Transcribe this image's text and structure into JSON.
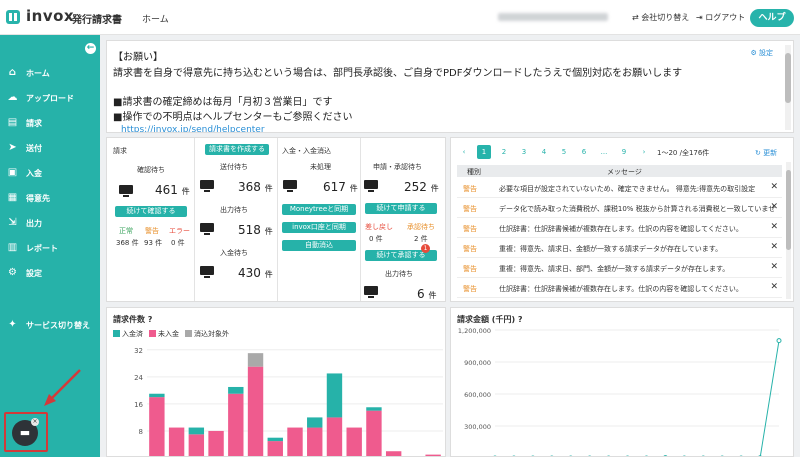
{
  "header": {
    "logo_text": "invox",
    "logo_sub": "発行請求書",
    "nav_home": "ホーム",
    "user_name": "",
    "switch_company": "会社切り替え",
    "logout": "ログアウト",
    "help": "ヘルプ"
  },
  "sidebar": {
    "items": [
      {
        "label": "ホーム",
        "icon": "home-icon"
      },
      {
        "label": "アップロード",
        "icon": "cloud-upload-icon"
      },
      {
        "label": "請求",
        "icon": "document-icon"
      },
      {
        "label": "送付",
        "icon": "send-icon"
      },
      {
        "label": "入金",
        "icon": "inbox-icon"
      },
      {
        "label": "得意先",
        "icon": "building-icon"
      },
      {
        "label": "出力",
        "icon": "export-icon"
      },
      {
        "label": "レポート",
        "icon": "bar-chart-icon"
      },
      {
        "label": "設定",
        "icon": "gear-icon"
      }
    ],
    "service_switch": "サービス切り替え"
  },
  "notice": {
    "title": "【お願い】",
    "lines": [
      "請求書を自身で得意先に持ち込むという場合は、部門長承認後、ご自身でPDFダウンロードしたうえで個別対応をお願いします",
      "■請求書の確定締めは毎月「月初３営業日」です",
      "■操作での不明点はヘルプセンターもご参照ください"
    ],
    "link": "https://invox.jp/send/helpcenter",
    "settings": "設定"
  },
  "status": {
    "invoice": {
      "section": "請求",
      "create_button": "請求書を作成する",
      "confirm_waiting_label": "確認待ち",
      "confirm_waiting_value": "461",
      "unit": "件",
      "continue_confirm": "続けて確認する",
      "normal_label": "正常",
      "normal_value": "368 件",
      "warning_label": "警告",
      "warning_value": "93 件",
      "error_label": "エラー",
      "error_value": "0 件"
    },
    "send": {
      "send_waiting_label": "送付待ち",
      "send_waiting_value": "368",
      "output_waiting_label": "出力待ち",
      "output_waiting_value": "518",
      "payment_waiting_label": "入金待ち",
      "payment_waiting_value": "430"
    },
    "payment": {
      "section": "入金・入金消込",
      "unprocessed_label": "未処理",
      "unprocessed_value": "617",
      "moneytree": "Moneytreeと同期",
      "invox_account": "invox口座と同期",
      "auto_clear": "自動消込"
    },
    "approval": {
      "label": "申請・承認待ち",
      "value": "252",
      "continue_apply": "続けて申請する",
      "returned_label": "差し戻し",
      "returned_value": "0 件",
      "approved_label": "承認待ち",
      "approved_value": "2 件",
      "continue_approve": "続けて承認する",
      "badge": "1",
      "output_waiting_label": "出力待ち",
      "output_waiting_value": "6"
    }
  },
  "messages": {
    "pagination": {
      "prev": "‹",
      "pages": [
        "1",
        "2",
        "3",
        "4",
        "5",
        "6",
        "...",
        "9"
      ],
      "next": "›",
      "range": "1〜20 /全176件",
      "refresh": "更新"
    },
    "col_kind": "種別",
    "col_message": "メッセージ",
    "rows": [
      {
        "kind": "警告",
        "text": "必要な項目が設定されていないため、確定できません。 得意先:得意先の取引設定"
      },
      {
        "kind": "警告",
        "text": "データ化で読み取った消費税が、課税10% 税抜から計算される消費税と一致していませ"
      },
      {
        "kind": "警告",
        "text": "仕訳辞書：仕訳辞書候補が複数存在します。仕訳の内容を確認してください。"
      },
      {
        "kind": "警告",
        "text": "重複：得意先、請求日、金額が一致する請求データが存在しています。"
      },
      {
        "kind": "警告",
        "text": "重複：得意先、請求日、部門、金額が一致する請求データが存在します。"
      },
      {
        "kind": "警告",
        "text": "仕訳辞書：仕訳辞書候補が複数存在します。仕訳の内容を確認してください。"
      },
      {
        "kind": "警告",
        "text": "仕訳辞書：仕訳辞書候補が複数存在します。仕訳の内容を確認してください。"
      }
    ]
  },
  "chart_data": [
    {
      "type": "bar",
      "title": "請求件数",
      "stacked": true,
      "ylim": [
        0,
        34
      ],
      "yticks": [
        "32",
        "24",
        "16",
        "8"
      ],
      "series": [
        {
          "name": "入金済",
          "color": "#26b2a9",
          "values": [
            1,
            0,
            2,
            0,
            2,
            0,
            1,
            0,
            3,
            13,
            0,
            1,
            0,
            0,
            0
          ]
        },
        {
          "name": "未入金",
          "color": "#ef5b8e",
          "values": [
            18,
            9,
            7,
            8,
            19,
            27,
            5,
            9,
            9,
            12,
            9,
            14,
            2,
            0,
            1
          ]
        },
        {
          "name": "消込対象外",
          "color": "#a9a9a9",
          "values": [
            0,
            0,
            0,
            0,
            0,
            4,
            0,
            0,
            0,
            0,
            0,
            0,
            0,
            0,
            0
          ]
        }
      ]
    },
    {
      "type": "line",
      "title": "請求金額 (千円)",
      "ylim": [
        0,
        1200000
      ],
      "yticks": [
        "1,200,000",
        "900,000",
        "600,000",
        "300,000"
      ],
      "series": [
        {
          "name": "請求金額",
          "color": "#26b2a9",
          "values": [
            0,
            0,
            0,
            0,
            0,
            0,
            0,
            0,
            0,
            3000,
            0,
            0,
            0,
            0,
            2000,
            1100000
          ]
        }
      ]
    }
  ]
}
